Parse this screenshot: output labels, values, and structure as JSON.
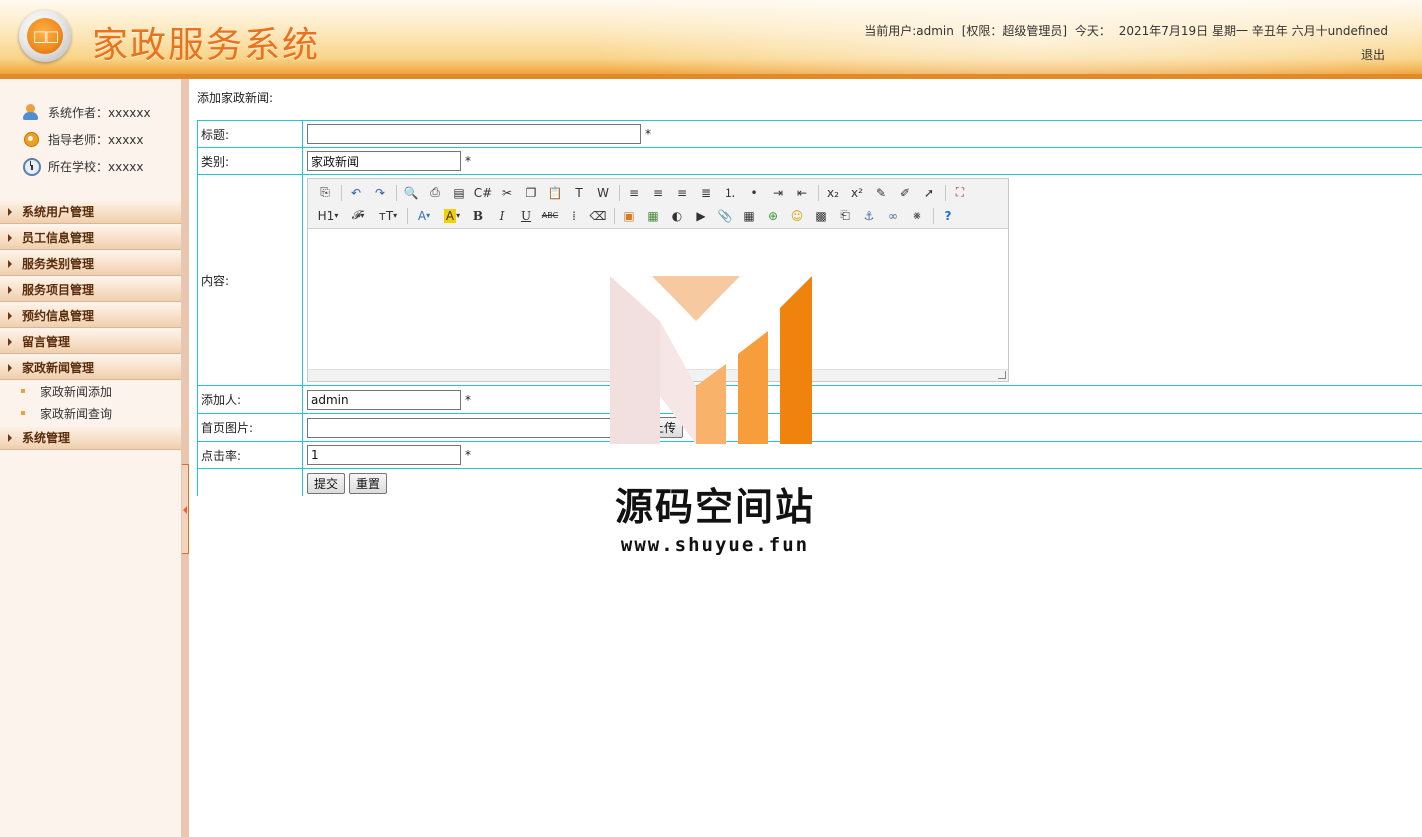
{
  "header": {
    "logo_text": "□□",
    "app_title": "家政服务系统",
    "current_user_label": "当前用户:admin",
    "role_label": "[权限：超级管理员]",
    "today_label": "今天：",
    "date_text": "2021年7月19日 星期一 辛丑年 六月十undefined",
    "logout_label": "退出",
    "colors": {
      "title": "#e8731c",
      "bar": "#e18a2a"
    }
  },
  "sidebar": {
    "info": [
      {
        "icon": "user-group-icon",
        "label": "系统作者：xxxxxx"
      },
      {
        "icon": "alarm-clock-icon",
        "label": "指导老师：xxxxx"
      },
      {
        "icon": "clock-icon",
        "label": "所在学校：xxxxx"
      }
    ],
    "menu": [
      {
        "label": "系统用户管理"
      },
      {
        "label": "员工信息管理"
      },
      {
        "label": "服务类别管理"
      },
      {
        "label": "服务项目管理"
      },
      {
        "label": "预约信息管理"
      },
      {
        "label": "留言管理"
      },
      {
        "label": "家政新闻管理",
        "children": [
          "家政新闻添加",
          "家政新闻查询"
        ]
      },
      {
        "label": "系统管理"
      }
    ]
  },
  "main": {
    "page_caption": "添加家政新闻:",
    "form": {
      "title_label": "标题:",
      "title_value": "",
      "title_required": "*",
      "category_label": "类别:",
      "category_value": "家政新闻",
      "category_required": "*",
      "content_label": "内容:",
      "author_label": "添加人:",
      "author_value": "admin",
      "author_required": "*",
      "image_label": "首页图片:",
      "image_value": "",
      "upload_label": "上传",
      "clicks_label": "点击率:",
      "clicks_value": "1",
      "clicks_required": "*",
      "submit_label": "提交",
      "reset_label": "重置"
    },
    "editor_toolbar": {
      "row1": [
        "source-icon",
        "undo-icon",
        "redo-icon",
        "preview-icon",
        "print-icon",
        "template-icon",
        "code-icon",
        "cut-icon",
        "copy-icon",
        "paste-icon",
        "paste-text-icon",
        "paste-word-icon",
        "align-left-icon",
        "align-center-icon",
        "align-right-icon",
        "justify-icon",
        "ordered-list-icon",
        "unordered-list-icon",
        "indent-icon",
        "outdent-icon",
        "subscript-icon",
        "superscript-icon",
        "clear-format-icon",
        "select-all-icon",
        "select-icon",
        "fullscreen-icon"
      ],
      "row2_text": {
        "heading": "H1",
        "font": "𝓕",
        "size": "тT",
        "forecolor": "A",
        "hilite": "A",
        "bold": "B",
        "italic": "I",
        "underline": "U",
        "strike": "ABC"
      },
      "row2": [
        "hr-icon",
        "eraser-icon",
        "image-icon",
        "multi-image-icon",
        "flash-icon",
        "media-icon",
        "attachment-icon",
        "table-icon",
        "insert-icon",
        "emoticon-icon",
        "image-manager-icon",
        "pagebreak-icon",
        "anchor-icon",
        "link-icon",
        "unlink-icon",
        "help-icon"
      ]
    }
  },
  "watermark": {
    "title": "源码空间站",
    "url": "www.shuyue.fun",
    "colors": [
      "#f2dfe0",
      "#f6c9a0",
      "#f9b26a",
      "#f79d3c",
      "#f0820e"
    ]
  }
}
